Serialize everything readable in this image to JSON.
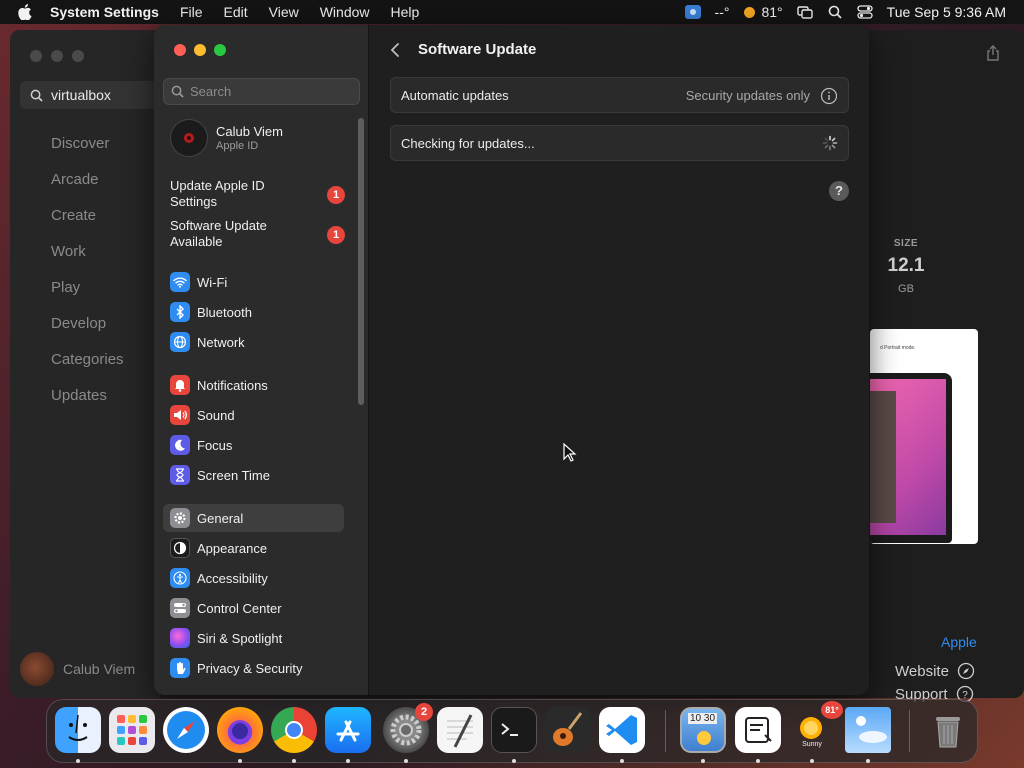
{
  "menubar": {
    "app_name": "System Settings",
    "menus": [
      "File",
      "Edit",
      "View",
      "Window",
      "Help"
    ],
    "status": {
      "weather_temp": "--°",
      "temperature": "81°",
      "datetime": "Tue Sep 5  9:36 AM"
    }
  },
  "appstore": {
    "search_value": "virtualbox",
    "nav": [
      "Discover",
      "Arcade",
      "Create",
      "Work",
      "Play",
      "Develop",
      "Categories",
      "Updates"
    ],
    "user_name": "Calub Viem",
    "size": {
      "label": "SIZE",
      "value": "12.1",
      "unit": "GB"
    },
    "screenshot_caption": "d Portrait mode.",
    "developer_link": "Apple",
    "links": [
      "Website",
      "Support"
    ]
  },
  "settings": {
    "search_placeholder": "Search",
    "profile": {
      "name": "Calub Viem",
      "subtitle": "Apple ID"
    },
    "notices": [
      {
        "label": "Update Apple ID Settings",
        "count": "1"
      },
      {
        "label": "Software Update Available",
        "count": "1"
      }
    ],
    "sidebar_items": [
      {
        "label": "Wi-Fi",
        "icon": "wifi-icon",
        "color": "#2f8cf0"
      },
      {
        "label": "Bluetooth",
        "icon": "bluetooth-icon",
        "color": "#2f8cf0"
      },
      {
        "label": "Network",
        "icon": "globe-icon",
        "color": "#2f8cf0"
      },
      {
        "label": "Notifications",
        "icon": "bell-icon",
        "color": "#e8453c"
      },
      {
        "label": "Sound",
        "icon": "speaker-icon",
        "color": "#e8453c"
      },
      {
        "label": "Focus",
        "icon": "moon-icon",
        "color": "#5e5ce6"
      },
      {
        "label": "Screen Time",
        "icon": "hourglass-icon",
        "color": "#5e5ce6"
      },
      {
        "label": "General",
        "icon": "gear-icon",
        "color": "#8e8e93"
      },
      {
        "label": "Appearance",
        "icon": "appearance-icon",
        "color": "#1c1c1c"
      },
      {
        "label": "Accessibility",
        "icon": "accessibility-icon",
        "color": "#2f8cf0"
      },
      {
        "label": "Control Center",
        "icon": "control-center-icon",
        "color": "#8e8e93"
      },
      {
        "label": "Siri & Spotlight",
        "icon": "siri-icon",
        "color": "#b14fd8"
      },
      {
        "label": "Privacy & Security",
        "icon": "hand-icon",
        "color": "#2f8cf0"
      }
    ],
    "content": {
      "title": "Software Update",
      "automatic_updates": {
        "label": "Automatic updates",
        "value": "Security updates only"
      },
      "checking": "Checking for updates...",
      "help": "?"
    }
  },
  "dock": {
    "settings_badge": "2",
    "weather_label": "Sunny",
    "weather_temp": "81°",
    "calendar_time": "10 30"
  }
}
